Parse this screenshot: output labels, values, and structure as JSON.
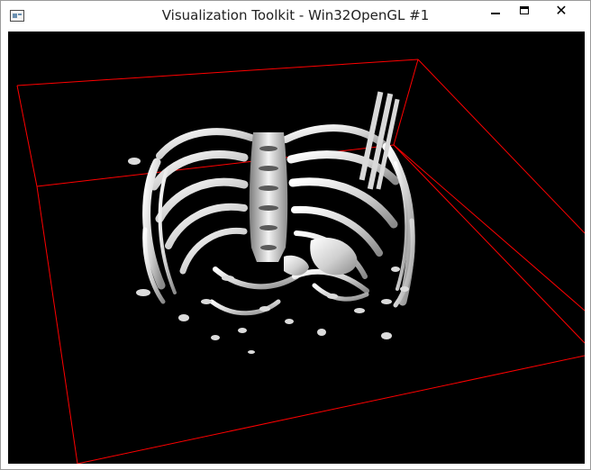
{
  "window": {
    "title": "Visualization Toolkit - Win32OpenGL #1",
    "controls": {
      "minimize": "minimize",
      "maximize": "maximize",
      "close": "✕"
    }
  },
  "scene": {
    "background_color": "#000000",
    "outline_color": "#ff0000",
    "surface_color": "#e6e6e6",
    "content": "isosurface of chest CT: rib cage and spine"
  }
}
